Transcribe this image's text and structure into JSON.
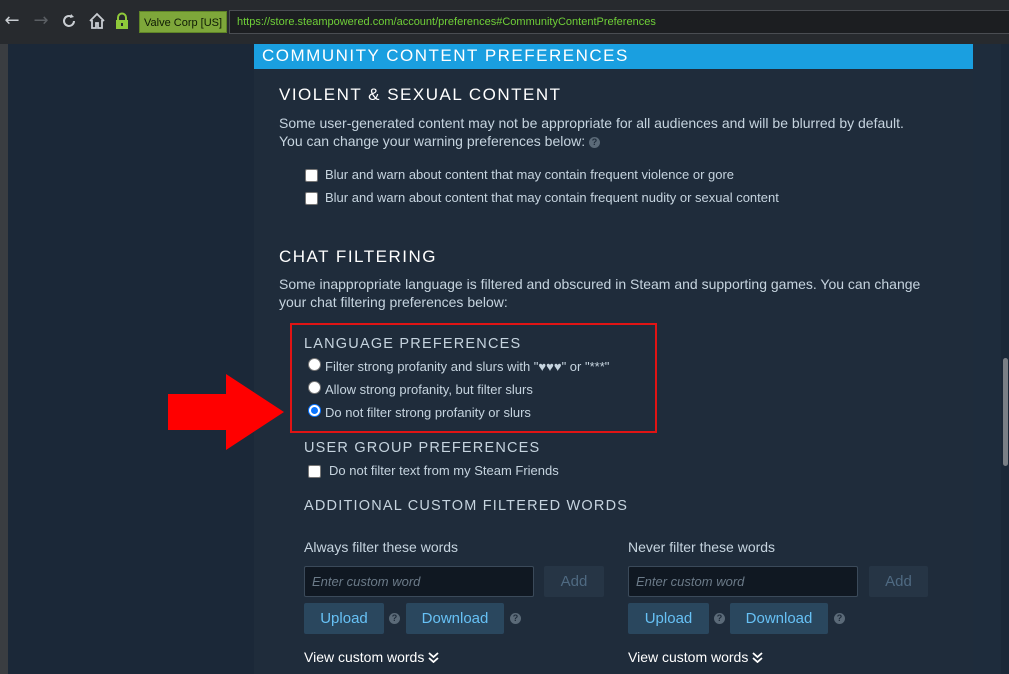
{
  "browser": {
    "back_icon": "arrow-left-icon",
    "forward_icon": "arrow-right-icon",
    "reload_icon": "reload-icon",
    "home_icon": "home-icon",
    "lock_icon": "lock-icon",
    "identity_badge": "Valve Corp [US]",
    "url": "https://store.steampowered.com/account/preferences#CommunityContentPreferences"
  },
  "panel": {
    "title": "COMMUNITY CONTENT PREFERENCES",
    "violent": {
      "heading": "VIOLENT & SEXUAL CONTENT",
      "desc_line1": "Some user-generated content may not be appropriate for all audiences and will be blurred by default.",
      "desc_line2": "You can change your warning preferences below:",
      "help_icon": "?",
      "options": [
        {
          "label": "Blur and warn about content that may contain frequent violence or gore",
          "checked": false
        },
        {
          "label": "Blur and warn about content that may contain frequent nudity or sexual content",
          "checked": false
        }
      ]
    },
    "chat": {
      "heading": "CHAT FILTERING",
      "desc_line1": "Some inappropriate language is filtered and obscured in Steam and supporting games. You can change",
      "desc_line2": "your chat filtering preferences below:",
      "language": {
        "heading": "LANGUAGE PREFERENCES",
        "options": [
          {
            "label": "Filter strong profanity and slurs with \"♥♥♥\" or \"***\"",
            "selected": false
          },
          {
            "label": "Allow strong profanity, but filter slurs",
            "selected": false
          },
          {
            "label": "Do not filter strong profanity or slurs",
            "selected": true
          }
        ]
      },
      "user_group": {
        "heading": "USER GROUP PREFERENCES",
        "option": {
          "label": "Do not filter text from my Steam Friends",
          "checked": false
        }
      },
      "custom": {
        "heading": "ADDITIONAL CUSTOM FILTERED WORDS",
        "always": {
          "label": "Always filter these words",
          "placeholder": "Enter custom word",
          "add": "Add",
          "upload": "Upload",
          "download": "Download",
          "view": "View custom words"
        },
        "never": {
          "label": "Never filter these words",
          "placeholder": "Enter custom word",
          "add": "Add",
          "upload": "Upload",
          "download": "Download",
          "view": "View custom words"
        },
        "help_icon": "?",
        "chevron_icon": "double-chevron-down-icon"
      }
    }
  },
  "annotation": {
    "arrow_color": "#ff0000",
    "box_color": "#e01414"
  },
  "colors": {
    "accent": "#1a9fe0",
    "panel_bg": "#1f2c3b",
    "page_bg": "#1b2838",
    "link_blue": "#67c1f5",
    "url_green": "#6fcf38"
  }
}
